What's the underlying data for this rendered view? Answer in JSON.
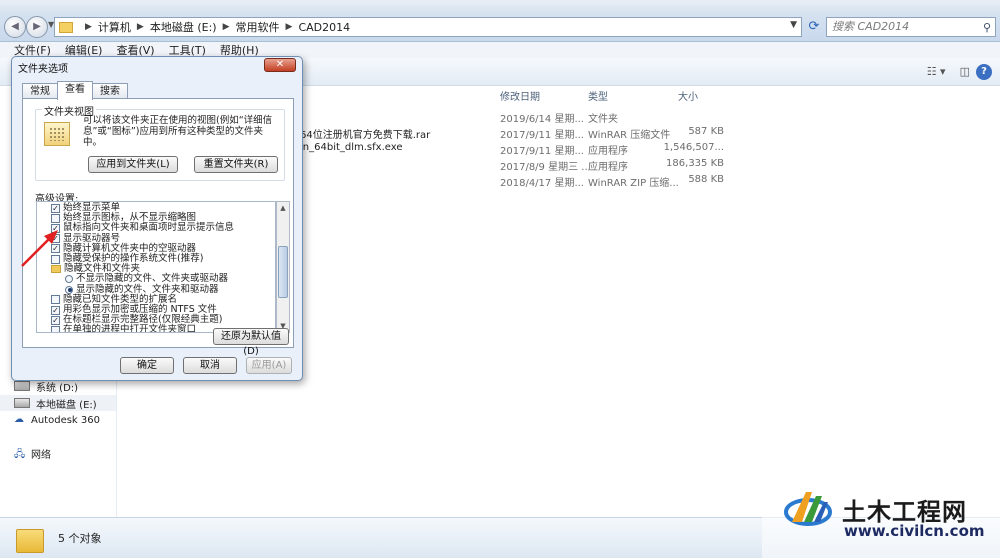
{
  "address": {
    "crumbs": [
      "计算机",
      "本地磁盘 (E:)",
      "常用软件",
      "CAD2014"
    ],
    "search_placeholder": "搜索 CAD2014"
  },
  "menu": [
    "文件(F)",
    "编辑(E)",
    "查看(V)",
    "工具(T)",
    "帮助(H)"
  ],
  "columns": {
    "modified": "修改日期",
    "type": "类型",
    "size": "大小"
  },
  "files": [
    {
      "name": "",
      "modified": "2019/6/14 星期...",
      "type": "文件夹",
      "size": ""
    },
    {
      "name": "64位注册机官方免费下载.rar",
      "modified": "2017/9/11 星期...",
      "type": "WinRAR 压缩文件",
      "size": "587 KB"
    },
    {
      "name": "in_64bit_dlm.sfx.exe",
      "modified": "2017/9/11 星期...",
      "type": "应用程序",
      "size": "1,546,507..."
    },
    {
      "name": "",
      "modified": "2017/8/9 星期三 ...",
      "type": "应用程序",
      "size": "186,335 KB"
    },
    {
      "name": "",
      "modified": "2018/4/17 星期...",
      "type": "WinRAR ZIP 压缩...",
      "size": "588 KB"
    }
  ],
  "nav": {
    "drive_d": "系统 (D:)",
    "drive_e": "本地磁盘 (E:)",
    "autodesk": "Autodesk 360",
    "network": "网络"
  },
  "status": {
    "count": "5 个对象"
  },
  "dialog": {
    "title": "文件夹选项",
    "tabs": [
      "常规",
      "查看",
      "搜索"
    ],
    "group_label": "文件夹视图",
    "group_desc": "可以将该文件夹正在使用的视图(例如“详细信息”或“图标”)应用到所有这种类型的文件夹中。",
    "apply_button": "应用到文件夹(L)",
    "reset_button": "重置文件夹(R)",
    "advanced_label": "高级设置:",
    "settings": [
      {
        "kind": "cb",
        "checked": true,
        "text": "始终显示菜单",
        "indent": 1
      },
      {
        "kind": "cb",
        "checked": false,
        "text": "始终显示图标，从不显示缩略图",
        "indent": 1
      },
      {
        "kind": "cb",
        "checked": true,
        "text": "鼠标指向文件夹和桌面项时显示提示信息",
        "indent": 1
      },
      {
        "kind": "cb",
        "checked": true,
        "text": "显示驱动器号",
        "indent": 1
      },
      {
        "kind": "cb",
        "checked": true,
        "text": "隐藏计算机文件夹中的空驱动器",
        "indent": 1
      },
      {
        "kind": "cb",
        "checked": false,
        "text": "隐藏受保护的操作系统文件(推荐)",
        "indent": 1
      },
      {
        "kind": "folder",
        "checked": false,
        "text": "隐藏文件和文件夹",
        "indent": 1
      },
      {
        "kind": "rb",
        "checked": false,
        "text": "不显示隐藏的文件、文件夹或驱动器",
        "indent": 2
      },
      {
        "kind": "rb",
        "checked": true,
        "text": "显示隐藏的文件、文件夹和驱动器",
        "indent": 2
      },
      {
        "kind": "cb",
        "checked": false,
        "text": "隐藏已知文件类型的扩展名",
        "indent": 1
      },
      {
        "kind": "cb",
        "checked": true,
        "text": "用彩色显示加密或压缩的 NTFS 文件",
        "indent": 1
      },
      {
        "kind": "cb",
        "checked": true,
        "text": "在标题栏显示完整路径(仅限经典主题)",
        "indent": 1
      },
      {
        "kind": "cb",
        "checked": false,
        "text": "在单独的进程中打开文件夹窗口",
        "indent": 1
      }
    ],
    "restore_button": "还原为默认值(D)",
    "ok_button": "确定",
    "cancel_button": "取消",
    "apply_footer_button": "应用(A)"
  },
  "watermark": {
    "title": "土木工程网",
    "url": "www.civilcn.com"
  }
}
